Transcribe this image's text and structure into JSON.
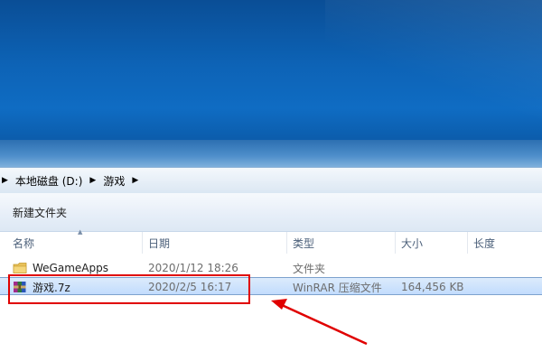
{
  "breadcrumb": {
    "items": [
      "本地磁盘 (D:)",
      "游戏"
    ]
  },
  "toolbar": {
    "new_folder": "新建文件夹"
  },
  "columns": {
    "name": "名称",
    "date": "日期",
    "type": "类型",
    "size": "大小",
    "length": "长度"
  },
  "files": [
    {
      "name": "WeGameApps",
      "date": "2020/1/12 18:26",
      "type": "文件夹",
      "size": "",
      "icon": "folder-icon",
      "selected": false
    },
    {
      "name": "游戏.7z",
      "date": "2020/2/5 16:17",
      "type": "WinRAR 压缩文件",
      "size": "164,456 KB",
      "icon": "winrar-archive-icon",
      "selected": true
    }
  ],
  "colors": {
    "highlight": "#e00000",
    "selection": "#c2dcfd",
    "desktop": "#0d63b6"
  }
}
